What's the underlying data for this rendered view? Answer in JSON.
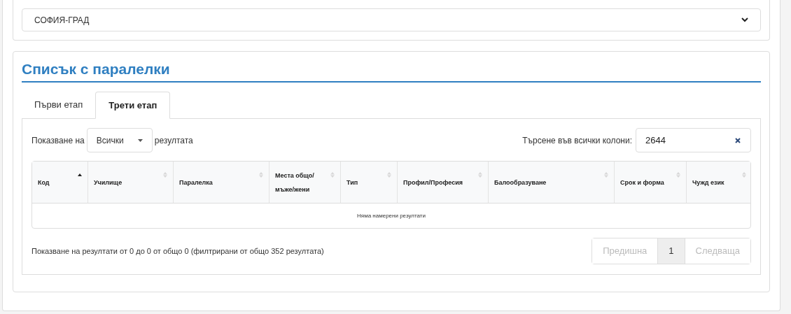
{
  "region_select": {
    "value": "СОФИЯ-ГРАД"
  },
  "section": {
    "title": "Списък с паралелки"
  },
  "tabs": [
    {
      "label": "Първи етап",
      "selected": false
    },
    {
      "label": "Трети етап",
      "selected": true
    }
  ],
  "length_control": {
    "prefix": "Показване на",
    "value": "Всички",
    "suffix": "резултата"
  },
  "search": {
    "label": "Търсене във всички колони:",
    "value": "2644"
  },
  "table": {
    "columns": [
      {
        "label": "Код",
        "sorted": true
      },
      {
        "label": "Училище",
        "sorted": false
      },
      {
        "label": "Паралелка",
        "sorted": false
      },
      {
        "label": "Места общо/ мъже/жени",
        "sorted": false
      },
      {
        "label": "Тип",
        "sorted": false
      },
      {
        "label": "Профил/Професия",
        "sorted": false
      },
      {
        "label": "Балообразуване",
        "sorted": false
      },
      {
        "label": "Срок и форма",
        "sorted": false
      },
      {
        "label": "Чужд език",
        "sorted": false
      }
    ],
    "empty_message": "Няма намерени резултати"
  },
  "info": "Показване на резултати от 0 до 0 от общо 0 (филтрирани от общо 352 резултата)",
  "pagination": [
    {
      "label": "Предишна",
      "disabled": true,
      "selected": false
    },
    {
      "label": "1",
      "disabled": false,
      "selected": true
    },
    {
      "label": "Следваща",
      "disabled": true,
      "selected": false
    }
  ]
}
